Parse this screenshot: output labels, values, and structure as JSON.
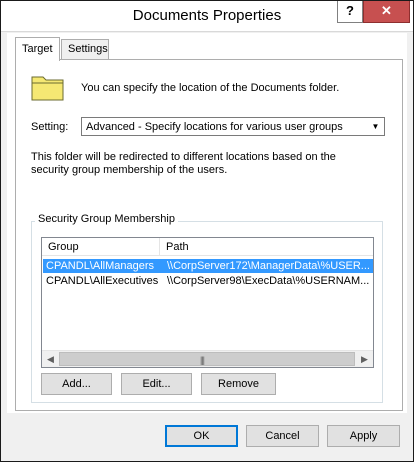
{
  "window": {
    "title": "Documents Properties",
    "help_glyph": "?",
    "close_glyph": "✕"
  },
  "tabs": [
    {
      "label": "Target"
    },
    {
      "label": "Settings"
    }
  ],
  "target": {
    "description": "You can specify the location of the Documents folder.",
    "setting_label": "Setting:",
    "setting_value": "Advanced - Specify locations for various user groups",
    "info": "This folder will be redirected to different locations based on the security group membership of the users."
  },
  "group": {
    "legend": "Security Group Membership",
    "columns": {
      "group": "Group",
      "path": "Path"
    },
    "rows": [
      {
        "group": "CPANDL\\AllManagers",
        "path": "\\\\CorpServer172\\ManagerData\\%USER...",
        "selected": true
      },
      {
        "group": "CPANDL\\AllExecutives",
        "path": "\\\\CorpServer98\\ExecData\\%USERNAM...",
        "selected": false
      }
    ],
    "add_label": "Add...",
    "edit_label": "Edit...",
    "remove_label": "Remove"
  },
  "footer": {
    "ok_label": "OK",
    "cancel_label": "Cancel",
    "apply_label": "Apply"
  },
  "icons": {
    "folder": "folder-icon",
    "dropdown": "chevron-down-icon"
  },
  "colors": {
    "selection": "#3399ff",
    "close_button": "#c75050",
    "folder": "#f5e873"
  }
}
